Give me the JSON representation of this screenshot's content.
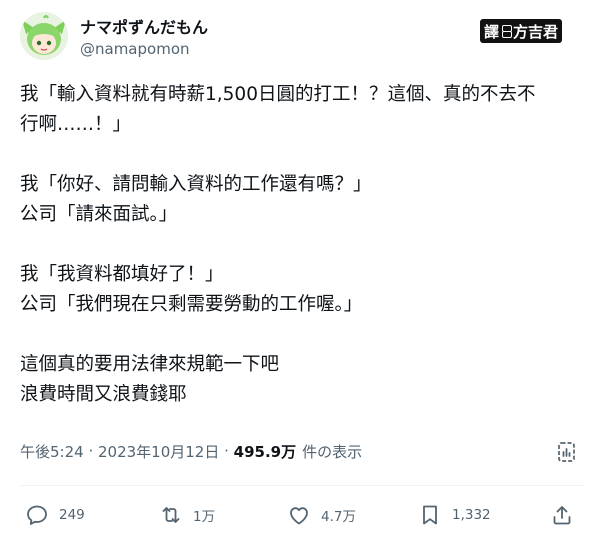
{
  "author": {
    "display_name": "ナマポずんだもん",
    "handle": "@namapomon"
  },
  "watermark": {
    "left": "譯",
    "right": "方吉君"
  },
  "tweet": {
    "lines": [
      "我「輸入資料就有時薪1,500日圓的打工！？這個、真的不去不",
      "行啊……！」",
      "",
      "我「你好、請問輸入資料的工作還有嗎？」",
      "公司「請來面試。」",
      "",
      "我「我資料都填好了！」",
      "公司「我們現在只剩需要勞動的工作喔。」",
      "",
      "這個真的要用法律來規範一下吧",
      "浪費時間又浪費錢耶"
    ]
  },
  "meta": {
    "time": "午後5:24",
    "separator1": " · ",
    "date": "2023年10月12日",
    "separator2": " · ",
    "views": "495.9万",
    "views_suffix": "件の表示"
  },
  "actions": {
    "reply": "249",
    "retweet": "1万",
    "like": "4.7万",
    "bookmark": "1,332"
  },
  "icons": {
    "reply": "speech-bubble-icon",
    "retweet": "retweet-arrows-icon",
    "like": "heart-icon",
    "bookmark": "bookmark-icon",
    "share": "share-upload-icon",
    "analytics": "analytics-icon"
  }
}
